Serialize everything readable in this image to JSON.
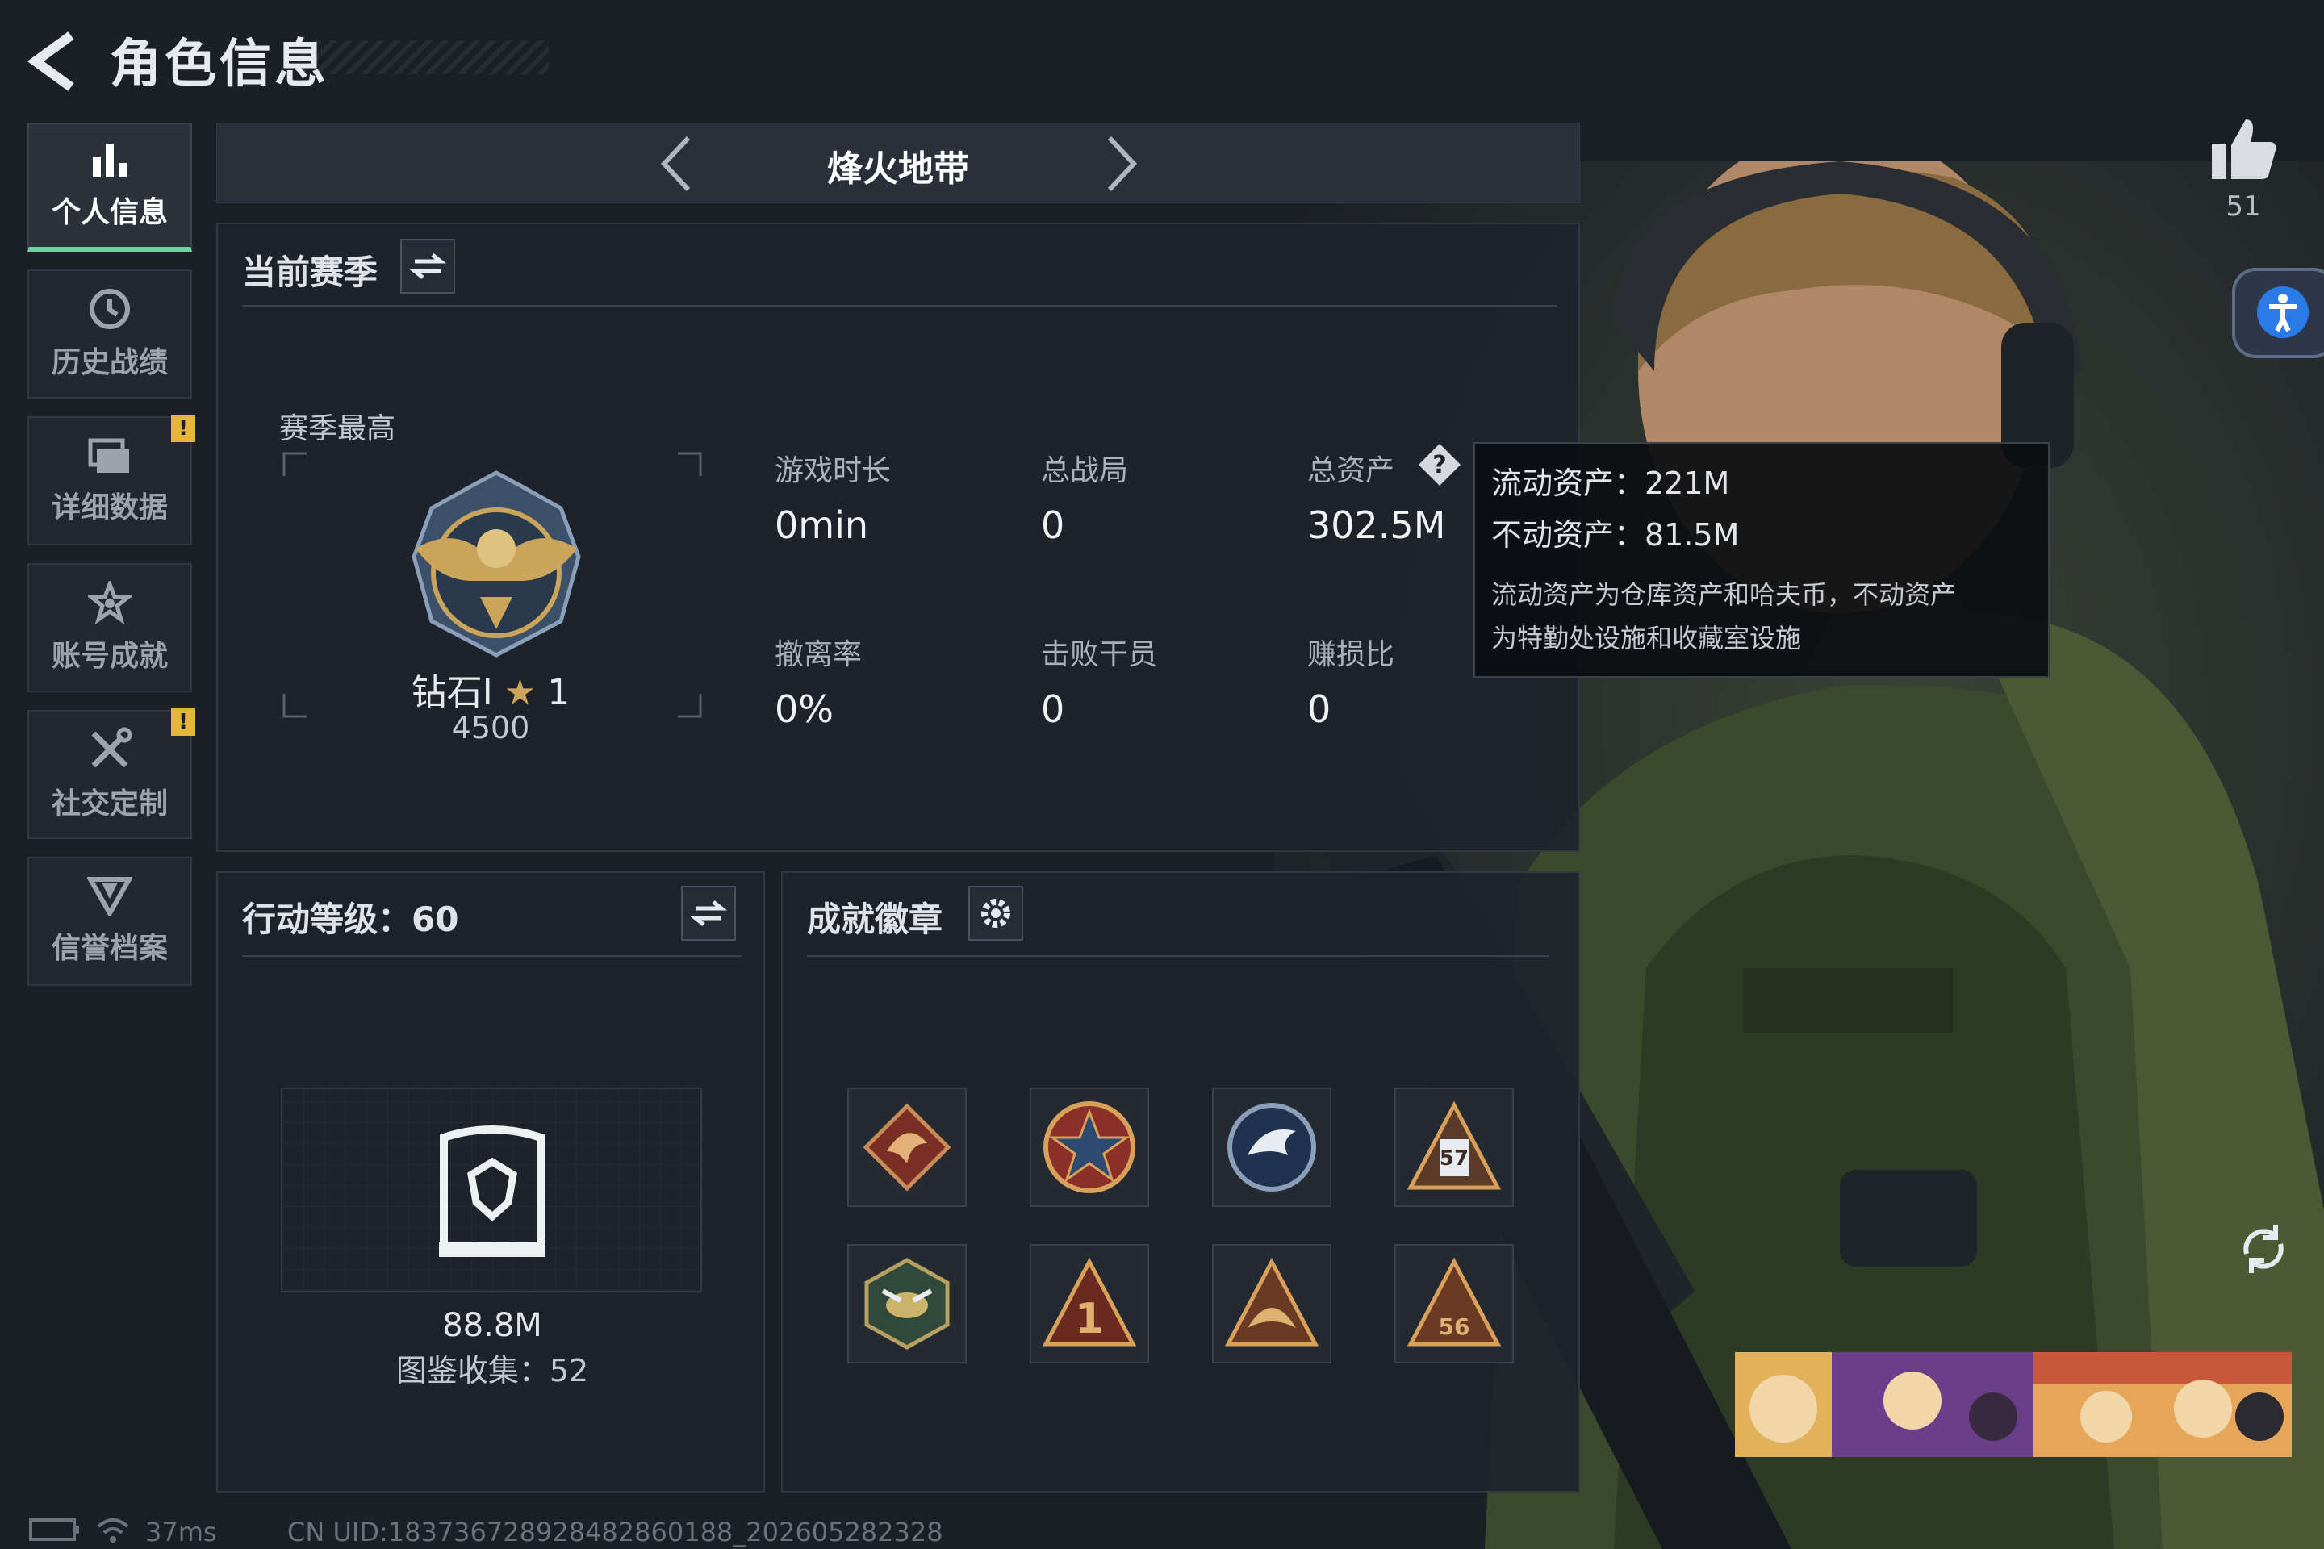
{
  "page": {
    "title": "角色信息"
  },
  "sidebar": {
    "items": [
      {
        "label": "个人信息",
        "icon": "bar-chart-icon",
        "active": true,
        "alert": false
      },
      {
        "label": "历史战绩",
        "icon": "history-clock-icon",
        "active": false,
        "alert": false
      },
      {
        "label": "详细数据",
        "icon": "folder-icon",
        "active": false,
        "alert": true
      },
      {
        "label": "账号成就",
        "icon": "achievement-star-icon",
        "active": false,
        "alert": false
      },
      {
        "label": "社交定制",
        "icon": "tools-icon",
        "active": false,
        "alert": true
      },
      {
        "label": "信誉档案",
        "icon": "shield-rank-icon",
        "active": false,
        "alert": false
      }
    ]
  },
  "alert_mark": "!",
  "mode": {
    "name": "烽火地带"
  },
  "season": {
    "title": "当前赛季",
    "best_label": "赛季最高",
    "rank_name": "钻石Ⅰ",
    "rank_stars": "1",
    "rank_points": "4500",
    "stats": [
      {
        "label": "游戏时长",
        "value": "0min"
      },
      {
        "label": "总战局",
        "value": "0"
      },
      {
        "label": "总资产",
        "value": "302.5M"
      },
      {
        "label": "撤离率",
        "value": "0%"
      },
      {
        "label": "击败干员",
        "value": "0"
      },
      {
        "label": "赚损比",
        "value": "0"
      }
    ]
  },
  "tooltip": {
    "liquid": "流动资产：221M",
    "fixed": "不动资产：81.5M",
    "desc1": "流动资产为仓库资产和哈夫币，不动资产",
    "desc2": "为特勤处设施和收藏室设施"
  },
  "action": {
    "title": "行动等级：60",
    "value": "88.8M",
    "collection": "图鉴收集：52"
  },
  "badges": {
    "title": "成就徽章",
    "items": [
      {
        "icon": "dragon-badge-icon",
        "text": ""
      },
      {
        "icon": "star-medal-badge-icon",
        "text": ""
      },
      {
        "icon": "eagle-badge-icon",
        "text": ""
      },
      {
        "icon": "triangle-badge-icon",
        "text": "57"
      },
      {
        "icon": "wasp-badge-icon",
        "text": ""
      },
      {
        "icon": "triangle-one-badge-icon",
        "text": "1"
      },
      {
        "icon": "triangle-wing-badge-icon",
        "text": ""
      },
      {
        "icon": "triangle-badge-icon",
        "text": "56"
      }
    ]
  },
  "likes": {
    "count": "51"
  },
  "status": {
    "ping": "37ms",
    "uid": "CN UID:183736728928482860188_202605282328"
  },
  "colors": {
    "accent": "#6bd3a0",
    "alert": "#e5b53a",
    "bg": "#1b1f26",
    "gold": "#c9a45a"
  }
}
